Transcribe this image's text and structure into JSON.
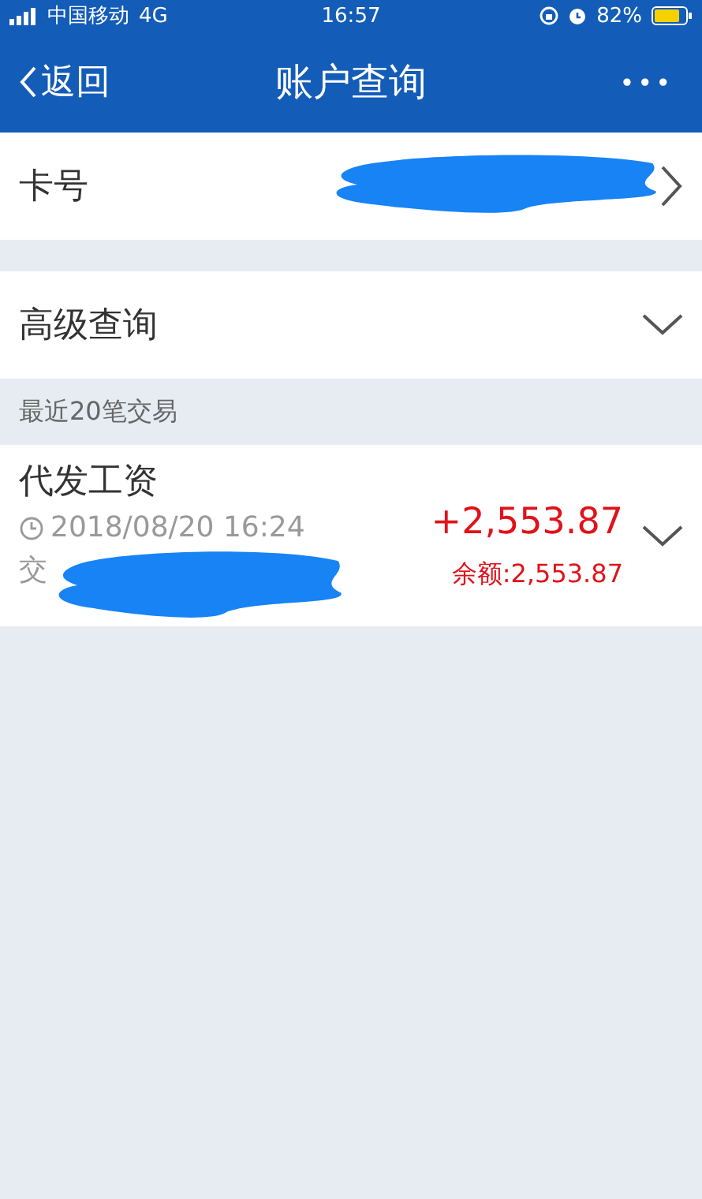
{
  "status_bar": {
    "carrier": "中国移动",
    "network": "4G",
    "time": "16:57",
    "battery_text": "82%"
  },
  "nav": {
    "back": "返回",
    "title": "账户查询",
    "more": "•••"
  },
  "card_row": {
    "label": "卡号"
  },
  "advanced": {
    "label": "高级查询",
    "expanded": false
  },
  "section": {
    "title": "最近20笔交易"
  },
  "transactions": [
    {
      "title": "代发工资",
      "datetime": "2018/08/20 16:24",
      "detail": "交",
      "amount": "+2,553.87",
      "balance": "余额:2,553.87",
      "expanded": false
    }
  ]
}
